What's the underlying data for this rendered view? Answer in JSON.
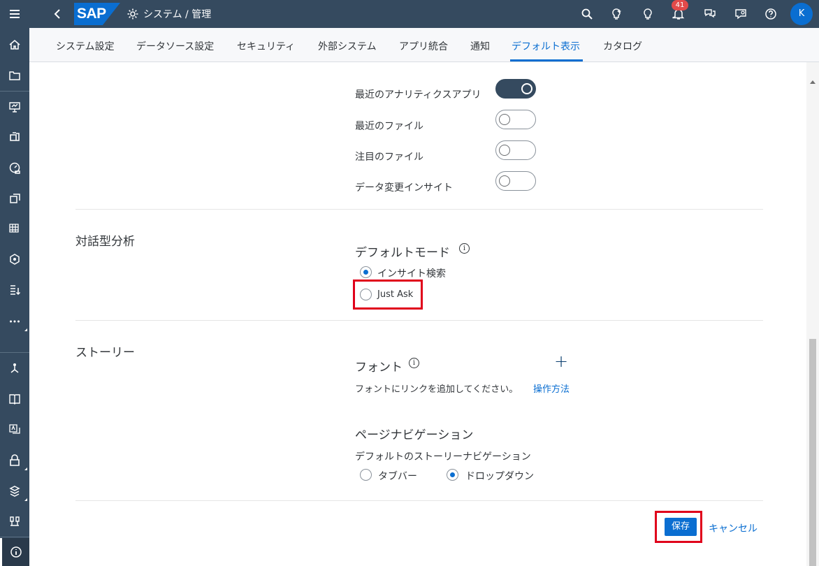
{
  "header": {
    "title": "システム / 管理",
    "logo": "SAP",
    "notification_count": "41",
    "avatar_initial": "K"
  },
  "tabs": [
    {
      "label": "システム設定"
    },
    {
      "label": "データソース設定"
    },
    {
      "label": "セキュリティ"
    },
    {
      "label": "外部システム"
    },
    {
      "label": "アプリ統合"
    },
    {
      "label": "通知"
    },
    {
      "label": "デフォルト表示",
      "active": true
    },
    {
      "label": "カタログ"
    }
  ],
  "toggles": [
    {
      "label": "最近のアナリティクスアプリ",
      "on": true
    },
    {
      "label": "最近のファイル",
      "on": false
    },
    {
      "label": "注目のファイル",
      "on": false
    },
    {
      "label": "データ変更インサイト",
      "on": false
    }
  ],
  "conversational": {
    "section_title": "対話型分析",
    "default_mode_label": "デフォルトモード",
    "options": [
      {
        "label": "インサイト検索",
        "selected": true
      },
      {
        "label": "Just Ask",
        "selected": false
      }
    ]
  },
  "story": {
    "section_title": "ストーリー",
    "font_label": "フォント",
    "add_icon": "+",
    "font_hint": "フォントにリンクを追加してください。",
    "font_help_link": "操作方法",
    "page_nav_title": "ページナビゲーション",
    "page_nav_sub": "デフォルトのストーリーナビゲーション",
    "nav_options": [
      {
        "label": "タブバー",
        "selected": false
      },
      {
        "label": "ドロップダウン",
        "selected": true
      }
    ]
  },
  "footer": {
    "save_label": "保存",
    "cancel_label": "キャンセル"
  },
  "colors": {
    "shell": "#354a5f",
    "accent": "#0a6ed1",
    "highlight": "#e0001b"
  },
  "icons": [
    "menu-icon",
    "back-icon",
    "gear-icon",
    "search-icon",
    "insight-icon",
    "lightbulb-icon",
    "bell-icon",
    "chat-icon",
    "feedback-icon",
    "help-icon",
    "home-icon",
    "folder-icon"
  ]
}
